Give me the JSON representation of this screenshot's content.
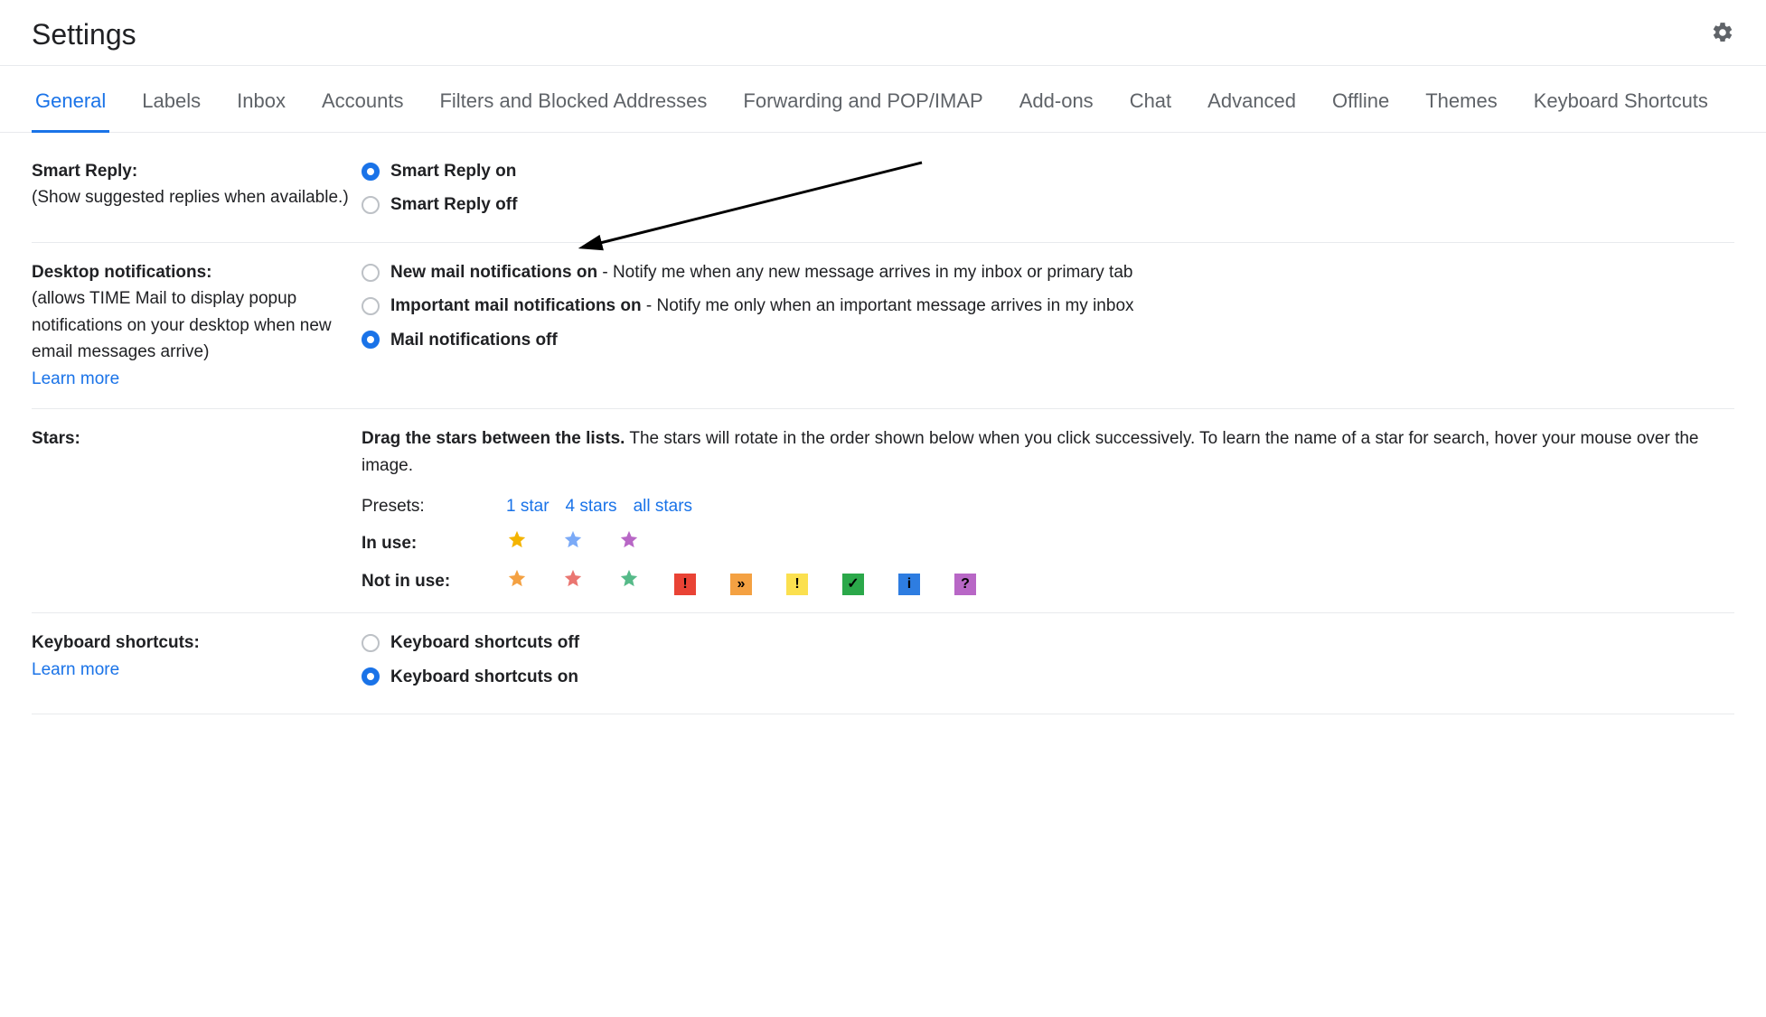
{
  "header": {
    "title": "Settings"
  },
  "tabs": [
    {
      "label": "General",
      "active": true
    },
    {
      "label": "Labels"
    },
    {
      "label": "Inbox"
    },
    {
      "label": "Accounts"
    },
    {
      "label": "Filters and Blocked Addresses"
    },
    {
      "label": "Forwarding and POP/IMAP"
    },
    {
      "label": "Add-ons"
    },
    {
      "label": "Chat"
    },
    {
      "label": "Advanced"
    },
    {
      "label": "Offline"
    },
    {
      "label": "Themes"
    },
    {
      "label": "Keyboard Shortcuts"
    }
  ],
  "smart_reply": {
    "title": "Smart Reply:",
    "desc": "(Show suggested replies when available.)",
    "on_label": "Smart Reply on",
    "off_label": "Smart Reply off",
    "selected": "on"
  },
  "desktop_notifications": {
    "title": "Desktop notifications:",
    "desc": "(allows TIME Mail to display popup notifications on your desktop when new email messages arrive)",
    "learn_more": "Learn more",
    "opt1_label": "New mail notifications on",
    "opt1_desc": " - Notify me when any new message arrives in my inbox or primary tab",
    "opt2_label": "Important mail notifications on",
    "opt2_desc": " - Notify me only when an important message arrives in my inbox",
    "opt3_label": "Mail notifications off",
    "selected": "off"
  },
  "stars": {
    "title": "Stars:",
    "intro_lead": "Drag the stars between the lists.",
    "intro_rest": "  The stars will rotate in the order shown below when you click successively. To learn the name of a star for search, hover your mouse over the image.",
    "presets_label": "Presets:",
    "preset1": "1 star",
    "preset2": "4 stars",
    "preset3": "all stars",
    "inuse_label": "In use:",
    "notinuse_label": "Not in use:",
    "in_use": [
      {
        "name": "yellow-star",
        "color": "#f4b400"
      },
      {
        "name": "blue-star",
        "color": "#7baaf7"
      },
      {
        "name": "purple-star",
        "color": "#b867c6"
      }
    ],
    "not_in_use_stars": [
      {
        "name": "orange-star",
        "color": "#f4a142"
      },
      {
        "name": "red-star",
        "color": "#ea7671"
      },
      {
        "name": "green-star",
        "color": "#56ba89"
      }
    ],
    "not_in_use_squares": [
      {
        "name": "red-bang",
        "bg": "#e94335",
        "glyph": "!",
        "fg": "#000"
      },
      {
        "name": "orange-guillemet",
        "bg": "#f4a142",
        "glyph": "»",
        "fg": "#000"
      },
      {
        "name": "yellow-bang",
        "bg": "#fbe04f",
        "glyph": "!",
        "fg": "#000"
      },
      {
        "name": "green-check",
        "bg": "#2ba84a",
        "glyph": "✓",
        "fg": "#000"
      },
      {
        "name": "blue-info",
        "bg": "#2e7de1",
        "glyph": "i",
        "fg": "#000"
      },
      {
        "name": "purple-question",
        "bg": "#b867c6",
        "glyph": "?",
        "fg": "#000"
      }
    ]
  },
  "keyboard_shortcuts": {
    "title": "Keyboard shortcuts:",
    "learn_more": "Learn more",
    "off_label": "Keyboard shortcuts off",
    "on_label": "Keyboard shortcuts on",
    "selected": "on"
  }
}
